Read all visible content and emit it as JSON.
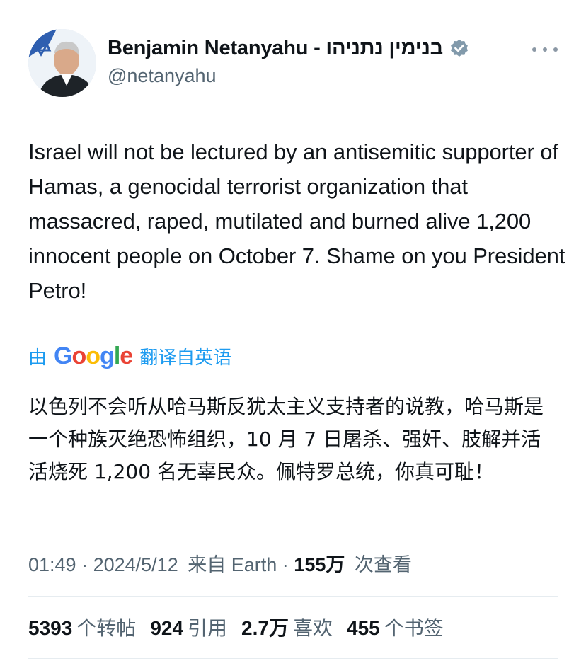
{
  "tweet": {
    "author_name": "Benjamin Netanyahu - בנימין נתניהו",
    "handle": "@netanyahu",
    "text": "Israel will not be lectured by an antisemitic supporter of Hamas, a genocidal terrorist organization that massacred, raped, mutilated and burned alive 1,200 innocent people on October 7. Shame on you President Petro!",
    "translation_prefix": "由",
    "translation_brand": "Google",
    "translation_suffix": "翻译自英语",
    "translated_text": "以色列不会听从哈马斯反犹太主义支持者的说教，哈马斯是一个种族灭绝恐怖组织，10 月 7 日屠杀、强奸、肢解并活活烧死 1,200 名无辜民众。佩特罗总统，你真可耻！",
    "time": "01:49",
    "date": "2024/5/12",
    "source": "来自 Earth",
    "views_count": "155万",
    "views_label": "次查看"
  },
  "stats": [
    {
      "count": "5393",
      "label": "个转帖"
    },
    {
      "count": "924",
      "label": "引用"
    },
    {
      "count": "2.7万",
      "label": "喜欢"
    },
    {
      "count": "455",
      "label": "个书签"
    }
  ],
  "icons": {
    "verified": "verified-badge-icon",
    "more": "more-options-icon"
  },
  "colors": {
    "link_blue": "#1d9bf0",
    "muted": "#536471",
    "verified_gray": "#829aab"
  }
}
